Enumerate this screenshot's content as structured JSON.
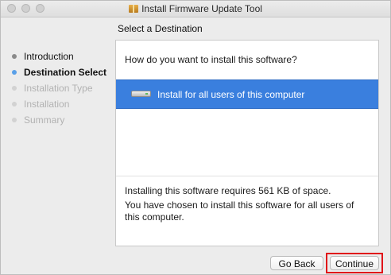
{
  "window": {
    "title": "Install Firmware Update Tool"
  },
  "section_title": "Select a Destination",
  "sidebar": {
    "steps": [
      {
        "label": "Introduction",
        "state": "done"
      },
      {
        "label": "Destination Select",
        "state": "current"
      },
      {
        "label": "Installation Type",
        "state": "future"
      },
      {
        "label": "Installation",
        "state": "future"
      },
      {
        "label": "Summary",
        "state": "future"
      }
    ]
  },
  "panel": {
    "question": "How do you want to install this software?",
    "option_label": "Install for all users of this computer",
    "requirement": "Installing this software requires 561 KB of space.",
    "chosen": "You have chosen to install this software for all users of this computer."
  },
  "buttons": {
    "back": "Go Back",
    "continue": "Continue"
  },
  "colors": {
    "selection": "#3a7fde",
    "highlight": "#e0141a",
    "current_step_dot": "#5aa0e8"
  }
}
